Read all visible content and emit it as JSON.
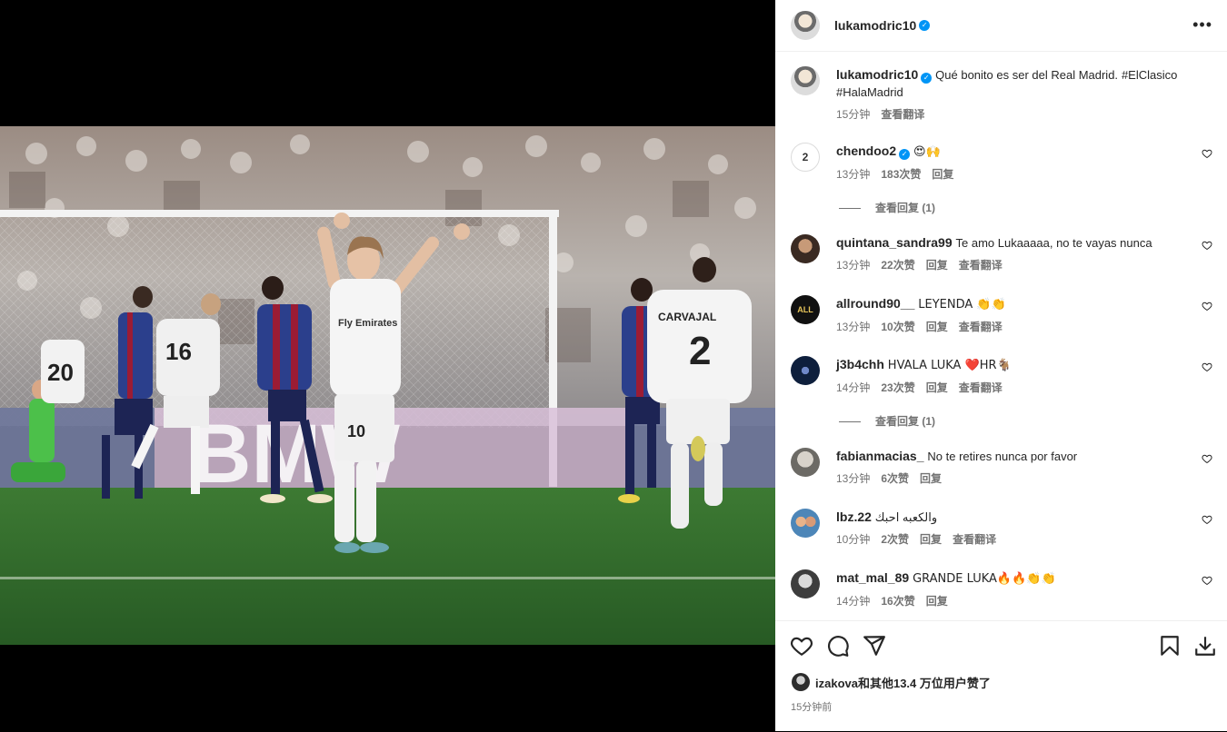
{
  "post": {
    "author": "lukamodric10",
    "caption_text": "Qué bonito es ser del Real Madrid.",
    "hashtag1": "#ElClasico",
    "hashtag2": "#HalaMadrid",
    "caption_time": "15分钟",
    "caption_translate": "查看翻译"
  },
  "photo": {
    "banner_text": "BMW",
    "shirt_center": "Fly Emirates",
    "player_number": "10",
    "back_name": "CARVAJAL",
    "back_number": "2",
    "left_number_1": "20",
    "left_number_2": "16"
  },
  "comments": [
    {
      "user": "chendoo2",
      "verified": true,
      "text": "😍🙌",
      "time": "13分钟",
      "likes": "183次赞",
      "reply": "回复",
      "translate": "",
      "avatar_text": "2"
    },
    {
      "user": "quintana_sandra99",
      "verified": false,
      "text": "Te amo Lukaaaaa, no te vayas nunca",
      "time": "13分钟",
      "likes": "22次赞",
      "reply": "回复",
      "translate": "查看翻译"
    },
    {
      "user": "allround90__",
      "verified": false,
      "text": "LEYENDA 👏👏",
      "time": "13分钟",
      "likes": "10次赞",
      "reply": "回复",
      "translate": "查看翻译",
      "avatar_text": "ALL"
    },
    {
      "user": "j3b4chh",
      "verified": false,
      "text": "HVALA LUKA ❤️HR🐐",
      "time": "14分钟",
      "likes": "23次赞",
      "reply": "回复",
      "translate": "查看翻译"
    },
    {
      "user": "fabianmacias_",
      "verified": false,
      "text": "No te retires nunca por favor",
      "time": "13分钟",
      "likes": "6次赞",
      "reply": "回复",
      "translate": ""
    },
    {
      "user": "lbz.22",
      "verified": false,
      "text": "والكعبه احبك",
      "time": "10分钟",
      "likes": "2次赞",
      "reply": "回复",
      "translate": "查看翻译"
    },
    {
      "user": "mat_mal_89",
      "verified": false,
      "text": "GRANDE LUKA🔥🔥👏👏",
      "time": "14分钟",
      "likes": "16次赞",
      "reply": "回复",
      "translate": ""
    }
  ],
  "view_replies_1": "查看回复 (1)",
  "view_replies_2": "查看回复 (1)",
  "footer": {
    "likes_text": "izakova和其他13.4 万位用户赞了",
    "post_time": "15分钟前"
  },
  "icons": [
    "more-icon",
    "heart-icon",
    "comment-icon",
    "share-icon",
    "save-icon",
    "download-icon",
    "verified-icon"
  ],
  "colors": {
    "verified": "#0095f6",
    "hashtag": "#00376b",
    "meta": "#737373",
    "pitch": "#2f6b2c"
  }
}
